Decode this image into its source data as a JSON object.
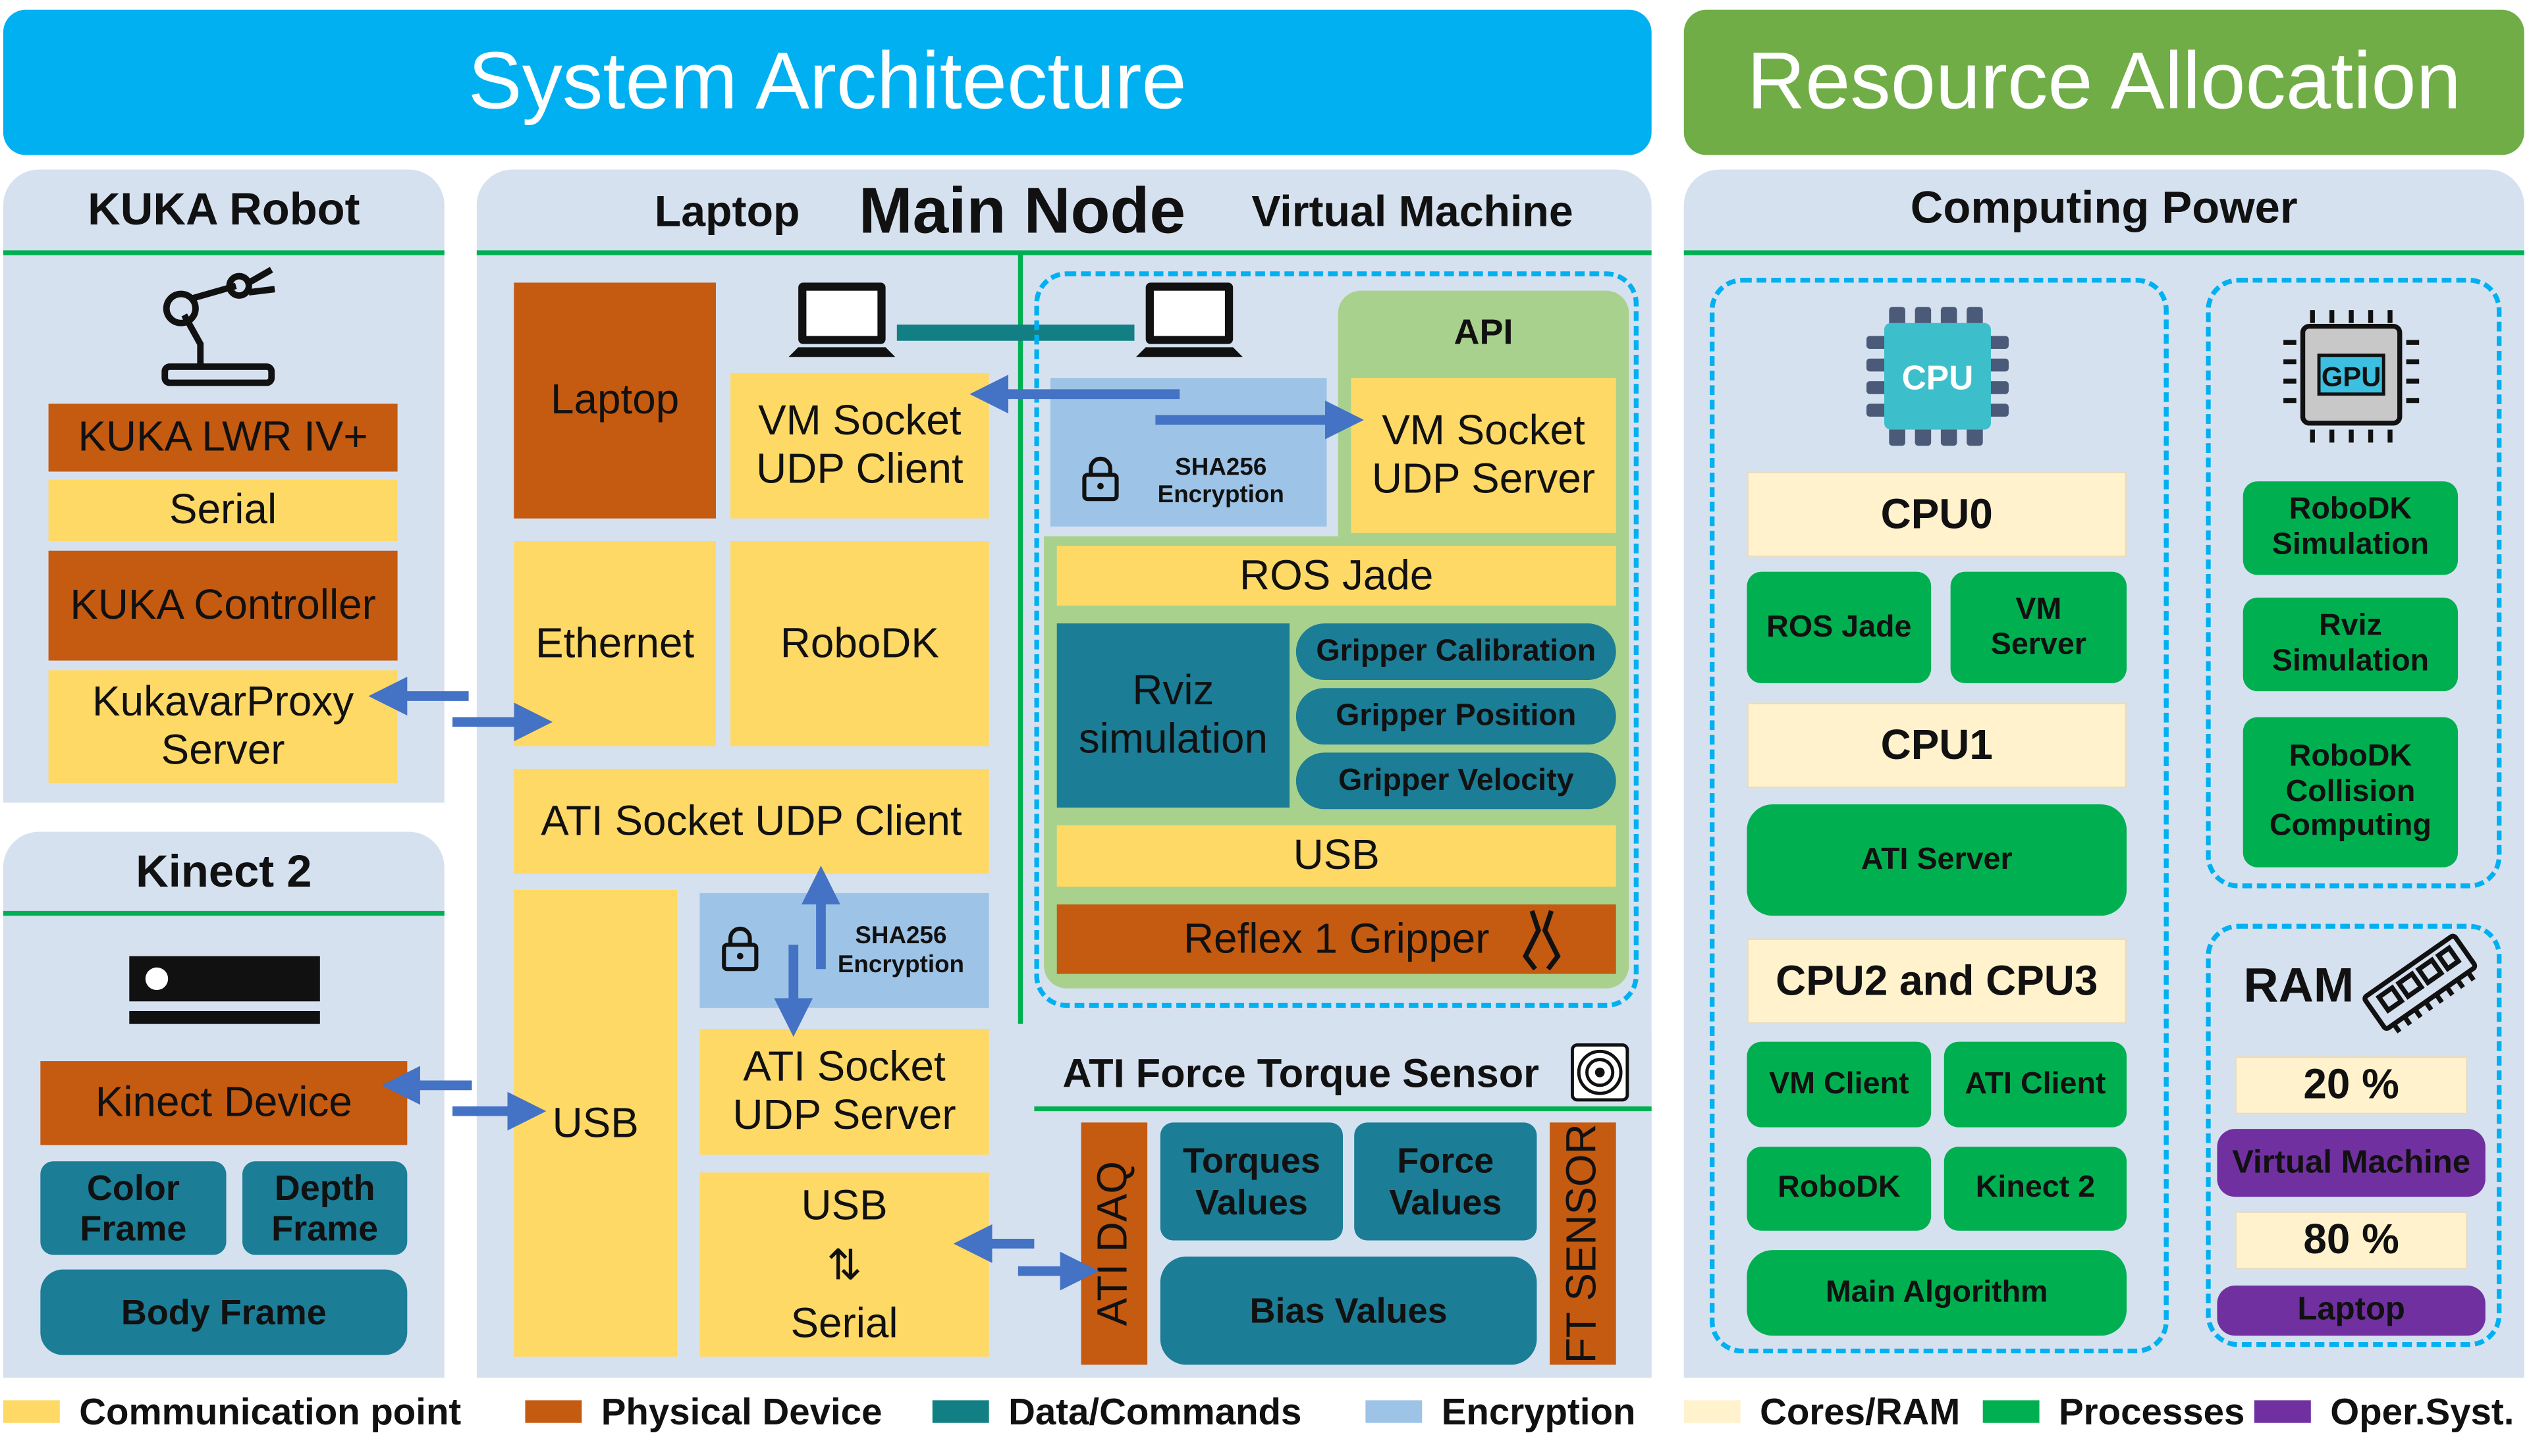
{
  "titles": {
    "system": "System Architecture",
    "resource": "Resource Allocation"
  },
  "colors": {
    "title_blue": "#00b0f0",
    "title_green": "#70ad47",
    "communication": "#ffd966",
    "physical": "#c55a11",
    "data": "#1b7d96",
    "encryption": "#9dc3e6",
    "cores": "#fff2cc",
    "processes": "#00b050",
    "os": "#7030a0",
    "arrow": "#4472c4"
  },
  "kuka": {
    "title": "KUKA Robot",
    "icon": "robot-arm-icon",
    "lwr": "KUKA LWR IV+",
    "serial": "Serial",
    "controller": "KUKA Controller",
    "proxy": "KukavarProxy Server"
  },
  "kinect": {
    "title": "Kinect 2",
    "icon": "kinect-sensor-icon",
    "device": "Kinect Device",
    "color_frame": "Color Frame",
    "depth_frame": "Depth Frame",
    "body_frame": "Body Frame"
  },
  "main": {
    "laptop_label": "Laptop",
    "title": "Main Node",
    "vm_label": "Virtual Machine",
    "laptop": "Laptop",
    "vm_client": "VM Socket UDP Client",
    "ethernet": "Ethernet",
    "robodk": "RoboDK",
    "ati_client": "ATI Socket UDP Client",
    "usb": "USB",
    "enc1": "SHA256 Encryption",
    "ati_server": "ATI Socket UDP Server",
    "usb_serial_top": "USB",
    "usb_serial_arrow": "⇅",
    "usb_serial_bottom": "Serial"
  },
  "vm": {
    "api": "API",
    "vm_server": "VM Socket UDP Server",
    "enc2": "SHA256 Encryption",
    "ros": "ROS Jade",
    "rviz": "Rviz simulation",
    "grip_cal": "Gripper Calibration",
    "grip_pos": "Gripper Position",
    "grip_vel": "Gripper Velocity",
    "usb": "USB",
    "gripper": "Reflex 1 Gripper"
  },
  "ati": {
    "title": "ATI Force Torque Sensor",
    "daq": "ATI DAQ",
    "torques": "Torques Values",
    "force": "Force Values",
    "bias": "Bias Values",
    "ft": "FT SENSOR"
  },
  "resource": {
    "title": "Computing Power",
    "cpu_icon": "CPU",
    "gpu_icon": "GPU",
    "cpu0": "CPU0",
    "ros": "ROS Jade",
    "vm_server": "VM Server",
    "cpu1": "CPU1",
    "ati_server": "ATI Server",
    "cpu23": "CPU2 and CPU3",
    "vm_client": "VM Client",
    "ati_client": "ATI Client",
    "robodk": "RoboDK",
    "kinect": "Kinect 2",
    "main_alg": "Main Algorithm",
    "gpu1": "RoboDK Simulation",
    "gpu2": "Rviz Simulation",
    "gpu3": "RoboDK Collision Computing",
    "ram": "RAM",
    "ram_vm_pct": "20 %",
    "ram_vm": "Virtual Machine",
    "ram_laptop_pct": "80 %",
    "ram_laptop": "Laptop"
  },
  "legend": [
    "Communication point",
    "Physical Device",
    "Data/Commands",
    "Encryption",
    "Cores/RAM",
    "Processes",
    "Oper.Syst."
  ]
}
